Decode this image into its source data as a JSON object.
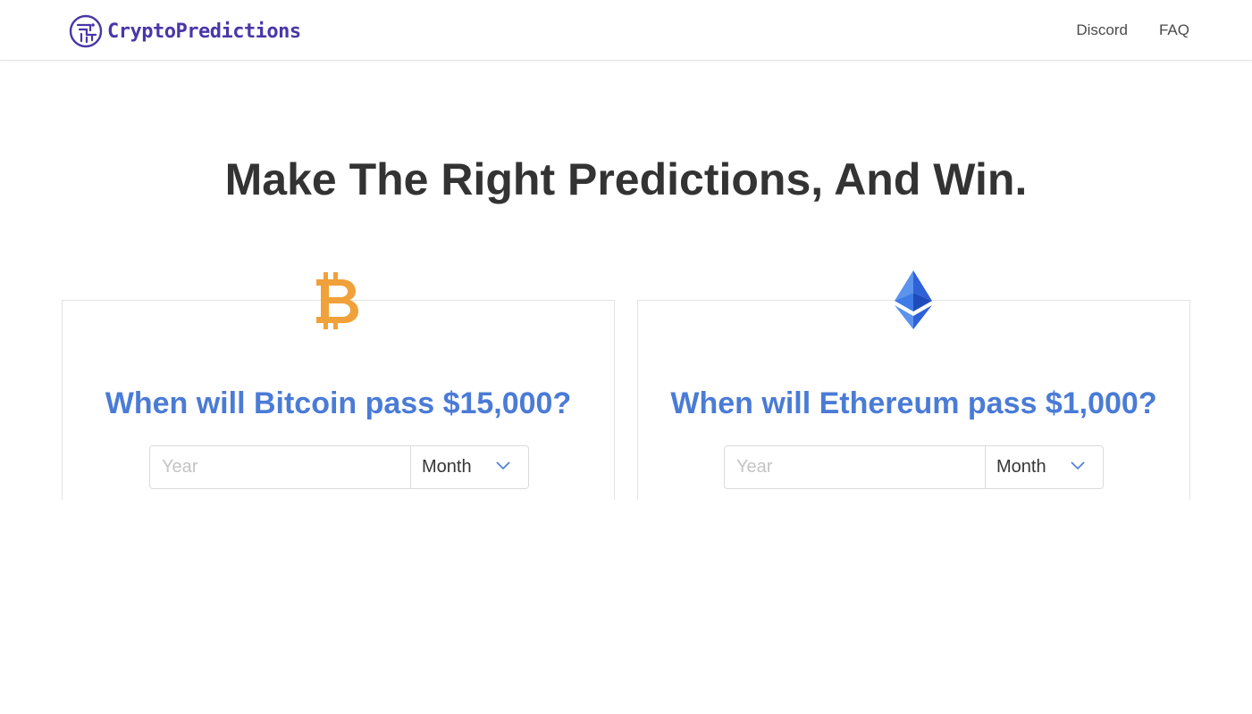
{
  "brand": {
    "name": "CryptoPredictions",
    "color": "#4a36a8"
  },
  "nav": {
    "links": [
      "Discord",
      "FAQ"
    ]
  },
  "hero": {
    "title": "Make The Right Predictions, And Win."
  },
  "cards": [
    {
      "coin": "bitcoin-icon",
      "question": "When will Bitcoin pass $15,000?",
      "year_placeholder": "Year",
      "year_value": "",
      "month_selected": "Month"
    },
    {
      "coin": "ethereum-icon",
      "question": "When will Ethereum pass $1,000?",
      "year_placeholder": "Year",
      "year_value": "",
      "month_selected": "Month"
    }
  ],
  "colors": {
    "accent": "#4a7bd6",
    "bitcoin": "#f0a13a",
    "ethereum": "#3b6fe0"
  }
}
